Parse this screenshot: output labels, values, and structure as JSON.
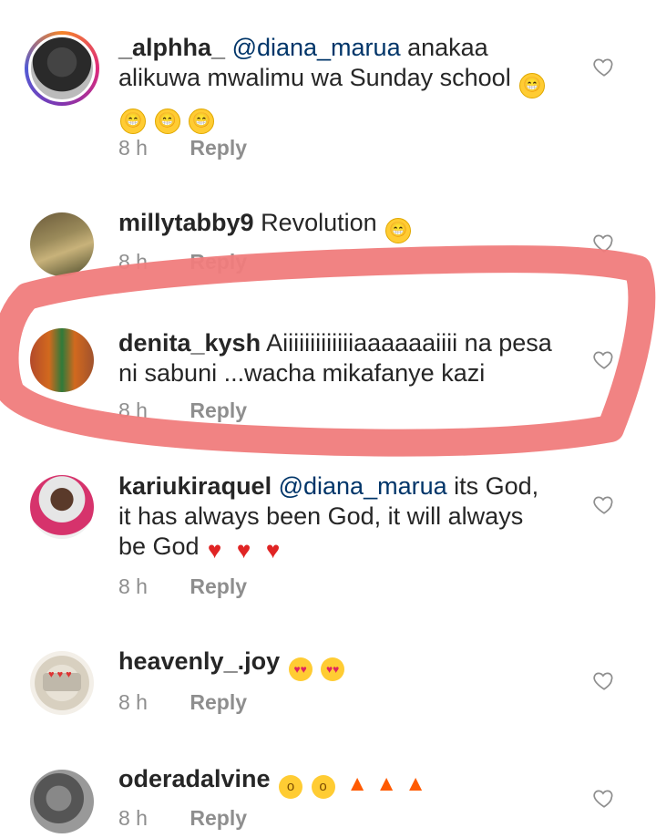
{
  "comments": [
    {
      "username": "_alphha_",
      "mention": "@diana_marua",
      "text": " anakaa alikuwa mwalimu wa Sunday school",
      "emojis": [
        "grinning-squinting-face-emoji",
        "grinning-squinting-face-emoji",
        "grinning-squinting-face-emoji",
        "grinning-squinting-face-emoji"
      ],
      "time": "8 h",
      "reply": "Reply",
      "avatar": "profile-photo-with-story-ring"
    },
    {
      "username": "millytabby9",
      "mention": "",
      "text": " Revolution",
      "emojis": [
        "grinning-squinting-face-emoji"
      ],
      "time": "8 h",
      "reply": "Reply",
      "avatar": "profile-photo-outdoor"
    },
    {
      "username": "denita_kysh",
      "mention": "",
      "text": " Aiiiiiiiiiiiiiaaaaaaiiii na pesa ni sabuni ...wacha mikafanye kazi",
      "emojis": [],
      "time": "8 h",
      "reply": "Reply",
      "avatar": "profile-photo-person-standing"
    },
    {
      "username": "kariukiraquel",
      "mention": "@diana_marua",
      "text": " its God, it has always been God, it will always be God",
      "emojis": [
        "red-heart-emoji",
        "red-heart-emoji",
        "red-heart-emoji"
      ],
      "time": "8 h",
      "reply": "Reply",
      "avatar": "profile-photo-selfie"
    },
    {
      "username": "heavenly_.joy",
      "mention": "",
      "text": " ",
      "emojis": [
        "heart-eyes-emoji",
        "heart-eyes-emoji"
      ],
      "time": "8 h",
      "reply": "Reply",
      "avatar": "profile-photo-hearts-graphic"
    },
    {
      "username": "oderadalvine",
      "mention": "",
      "text": " ",
      "emojis": [
        "face-with-open-mouth-emoji",
        "face-with-open-mouth-emoji",
        "fire-emoji",
        "fire-emoji",
        "fire-emoji"
      ],
      "time": "8 h",
      "reply": "Reply",
      "avatar": "profile-photo-grayscale"
    }
  ],
  "colors": {
    "username": "#262626",
    "mention": "#003569",
    "meta": "#8e8e8e",
    "highlight_stroke": "#f07c7c"
  }
}
